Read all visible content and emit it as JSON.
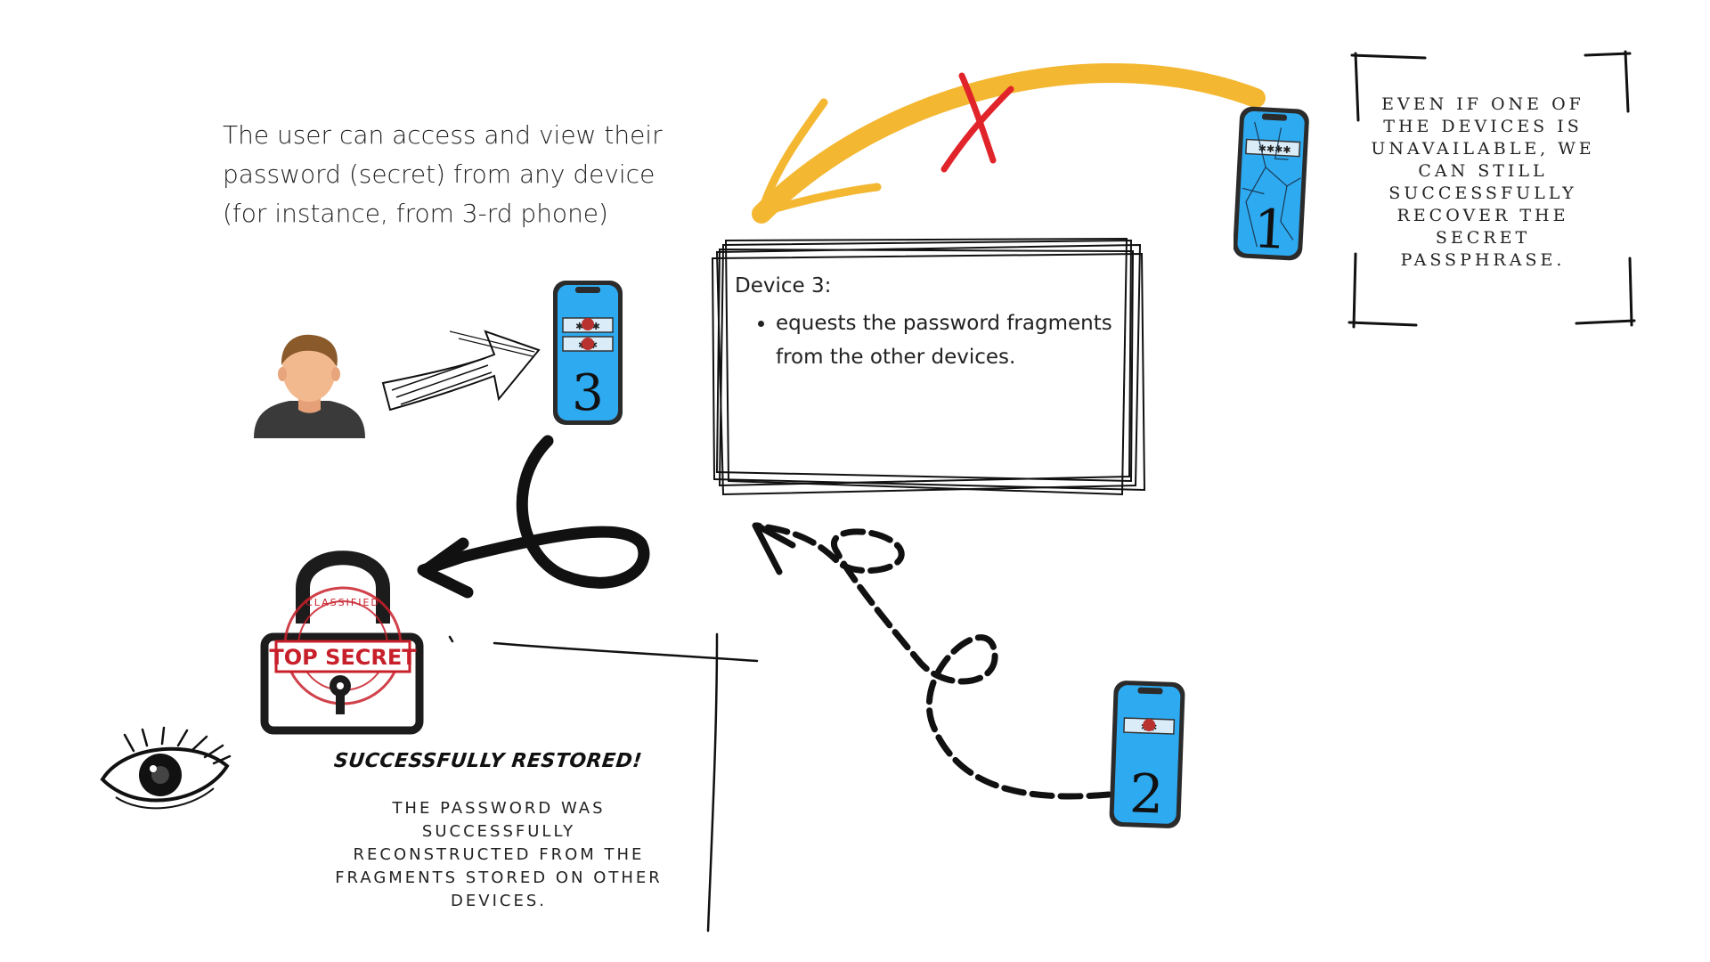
{
  "intro_text": "The user can access and view their password (secret) from any device (for instance, from 3-rd phone)",
  "device_box": {
    "title": "Device 3:",
    "bullets": [
      "equests the password fragments from the other devices."
    ]
  },
  "side_note": "Even if one of the devices is unavailable, we can still successfully recover the secret passphrase.",
  "result": {
    "title": "SUCCESSFULLY RESTORED!",
    "description": "The password was successfully reconstructed from the fragments stored on other devices."
  },
  "phones": [
    {
      "number": "3",
      "screen_label": "✱✱✱"
    },
    {
      "number": "1",
      "screen_label": "✱✱✱✱",
      "cracked": true
    },
    {
      "number": "2",
      "screen_label": "✱✱"
    }
  ],
  "stamp": {
    "main": "TOP SECRET",
    "ring": "CLASSIFIED"
  },
  "colors": {
    "phone_screen": "#2eaaf0",
    "arrow_yellow": "#f4b731",
    "cross_red": "#e0242a",
    "lock": "#1c1c1c",
    "stamp_red": "#c8202a"
  },
  "icons": [
    "user-avatar-icon",
    "phone-icon",
    "padlock-icon",
    "eye-icon",
    "cross-icon"
  ]
}
